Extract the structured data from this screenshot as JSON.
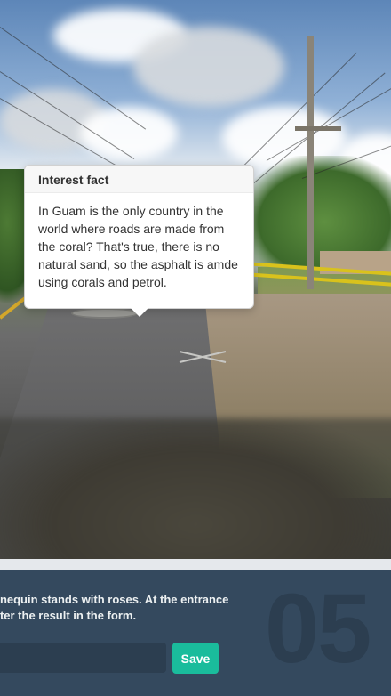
{
  "tooltip": {
    "title": "Interest fact",
    "body": "In Guam is the only country in the world where roads are made from the coral? That's true, there is no natural sand, so the asphalt is amde using corals and petrol."
  },
  "task": {
    "number": "05",
    "text_line1": "nnequin stands with roses. At the entrance",
    "text_line2": "nter the result in the form.",
    "input_value": "",
    "input_placeholder": "",
    "save_label": "Save"
  },
  "colors": {
    "panel_bg": "#34495e",
    "input_bg": "#2c3e50",
    "accent": "#1abc9c",
    "number_color": "#2c3e50"
  }
}
